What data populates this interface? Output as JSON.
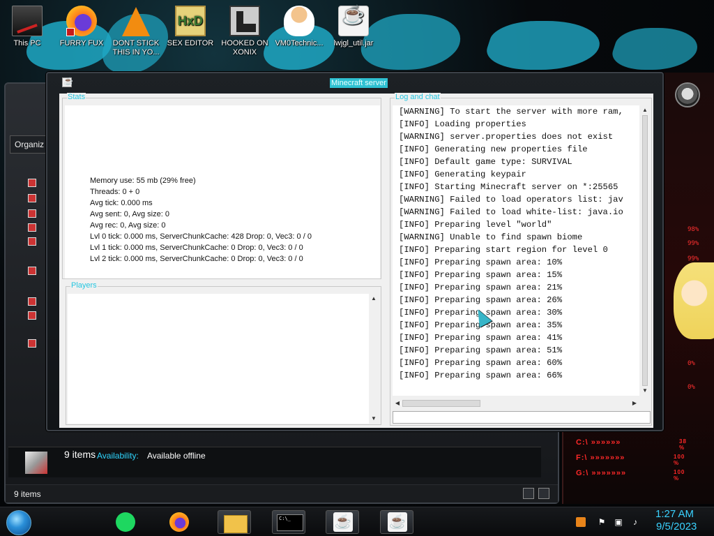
{
  "colors": {
    "accent_cyan": "#2fc1d2",
    "legend_cyan": "#24c6e0",
    "clock_cyan": "#3ad2ff",
    "alert_red": "#ff2828"
  },
  "desktop": {
    "icons": [
      {
        "label": "This PC",
        "icon": "computer-icon"
      },
      {
        "label": "FURRY FUX",
        "icon": "firefox-icon"
      },
      {
        "label": "DONT STICK THIS IN YO...",
        "icon": "vlc-icon"
      },
      {
        "label": "SEX EDITOR",
        "icon": "hxd-icon",
        "glyph": "HxD"
      },
      {
        "label": "HOOKED ON XONIX",
        "icon": "xonix-icon"
      },
      {
        "label": "VM0Technic...",
        "icon": "doctor-icon"
      },
      {
        "label": "lwjgl_util.jar",
        "icon": "java-jar-icon"
      }
    ]
  },
  "explorer": {
    "organize_label": "Organiz",
    "details": {
      "count": "9 items",
      "availability_label": "Availability:",
      "availability_value": "Available offline"
    },
    "status": {
      "count": "9 items"
    }
  },
  "side_panel": {
    "percents": [
      "98%",
      "99%",
      "99%",
      "0%",
      "0%"
    ],
    "red_rows": [
      {
        "label": "C:\\ »»»»»»",
        "value": "38 %"
      },
      {
        "label": "F:\\ »»»»»»»",
        "value": "100 %"
      },
      {
        "label": "G:\\ »»»»»»»",
        "value": "100 %"
      }
    ]
  },
  "mc_window": {
    "title": "Minecraft server",
    "stats": {
      "legend": "Stats",
      "lines": [
        "Memory use: 55 mb (29% free)",
        "Threads: 0 + 0",
        "Avg tick: 0.000 ms",
        "Avg sent: 0, Avg size: 0",
        "Avg rec: 0, Avg size: 0",
        "Lvl 0 tick: 0.000 ms, ServerChunkCache: 428 Drop: 0, Vec3: 0 / 0",
        "Lvl 1 tick: 0.000 ms, ServerChunkCache: 0 Drop: 0, Vec3: 0 / 0",
        "Lvl 2 tick: 0.000 ms, ServerChunkCache: 0 Drop: 0, Vec3: 0 / 0"
      ]
    },
    "players": {
      "legend": "Players"
    },
    "log": {
      "legend": "Log and chat",
      "lines": [
        "[WARNING] To start the server with more ram,",
        "[INFO] Loading properties",
        "[WARNING] server.properties does not exist",
        "[INFO] Generating new properties file",
        "[INFO] Default game type: SURVIVAL",
        "[INFO] Generating keypair",
        "[INFO] Starting Minecraft server on *:25565",
        "[WARNING] Failed to load operators list: jav",
        "[WARNING] Failed to load white-list: java.io",
        "[INFO] Preparing level \"world\"",
        "[WARNING] Unable to find spawn biome",
        "[INFO] Preparing start region for level 0",
        "[INFO] Preparing spawn area: 10%",
        "[INFO] Preparing spawn area: 15%",
        "[INFO] Preparing spawn area: 21%",
        "[INFO] Preparing spawn area: 26%",
        "[INFO] Preparing spawn area: 30%",
        "[INFO] Preparing spawn area: 35%",
        "[INFO] Preparing spawn area: 41%",
        "[INFO] Preparing spawn area: 51%",
        "[INFO] Preparing spawn area: 60%",
        "[INFO] Preparing spawn area: 66%"
      ]
    }
  },
  "taskbar": {
    "items": [
      {
        "name": "spotify",
        "icon": "spotify-icon"
      },
      {
        "name": "firefox",
        "icon": "firefox-icon"
      },
      {
        "name": "file-explorer",
        "icon": "folder-icon"
      },
      {
        "name": "command-prompt",
        "icon": "terminal-icon"
      },
      {
        "name": "java-app-1",
        "icon": "java-icon"
      },
      {
        "name": "java-app-2",
        "icon": "java-icon"
      }
    ],
    "clock": {
      "time": "1:27 AM",
      "date": "9/5/2023"
    }
  }
}
